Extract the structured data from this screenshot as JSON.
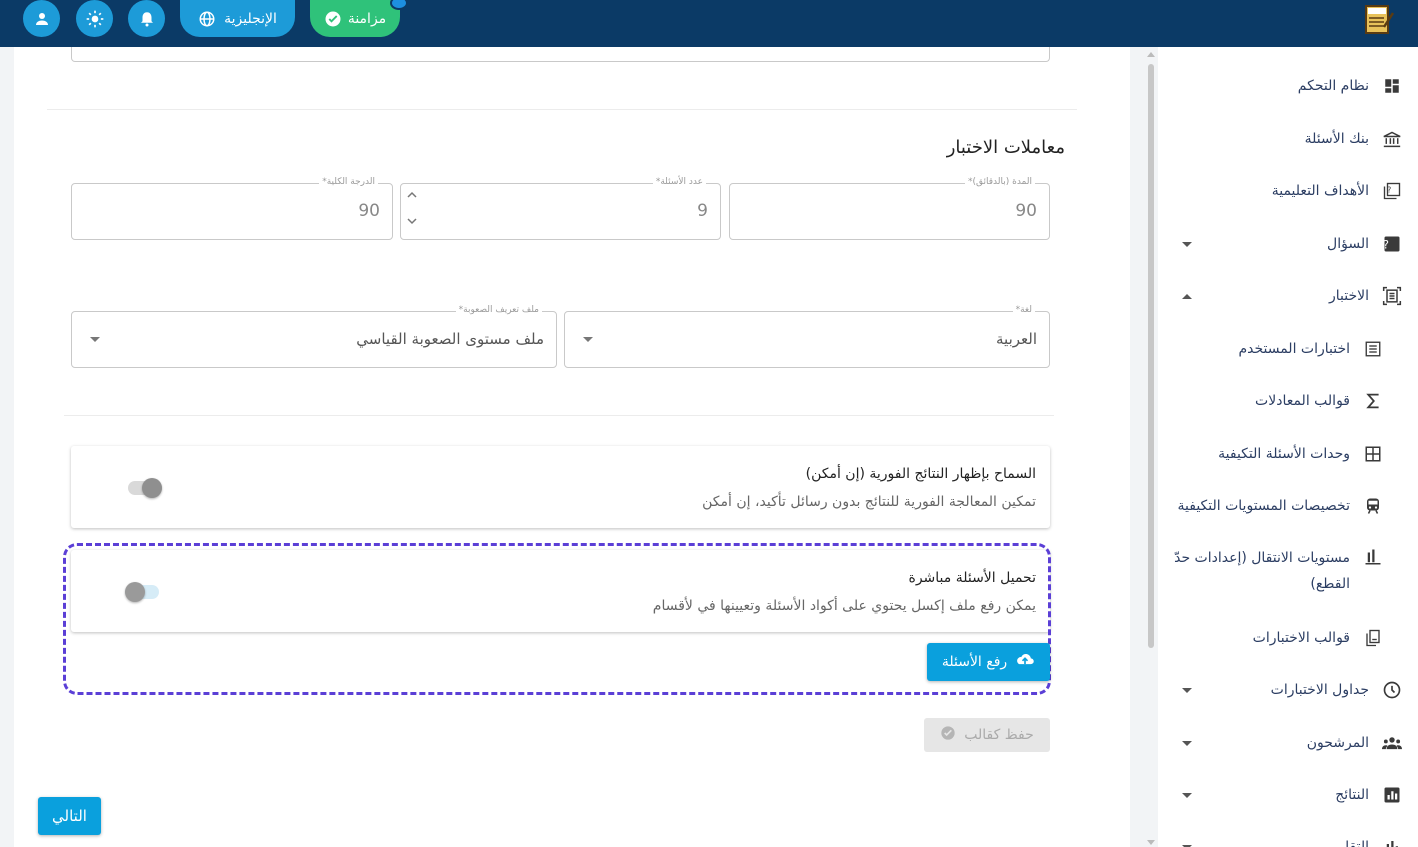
{
  "header": {
    "language_label": "الإنجليزية",
    "sync_label": "مزامنة",
    "icons": [
      "user-icon",
      "sun-icon",
      "bell-icon",
      "globe-icon",
      "check-circle-icon",
      "exam-logo-icon"
    ]
  },
  "main": {
    "section_title": "معاملات الاختبار",
    "fields": {
      "total_score": {
        "label": "الدرجة الكلية*",
        "value": "90"
      },
      "question_count": {
        "label": "عدد الأسئلة*",
        "value": "9"
      },
      "duration": {
        "label": "المدة (بالدقائق)*",
        "value": "90"
      },
      "difficulty_profile": {
        "label": "ملف تعريف الصعوبة*",
        "value": "ملف مستوى الصعوبة القياسي"
      },
      "language": {
        "label": "لغة*",
        "value": "العربية"
      }
    },
    "instant_results": {
      "title": "السماح بإظهار النتائج الفورية (إن أمكن)",
      "description": "تمكين المعالجة الفورية للنتائج بدون رسائل تأكيد، إن أمكن",
      "enabled": true
    },
    "direct_upload": {
      "title": "تحميل الأسئلة مباشرة",
      "description": "يمكن رفع ملف إكسل يحتوي على أكواد الأسئلة وتعيينها في لأقسام",
      "enabled": false,
      "upload_button": "رفع الأسئلة"
    },
    "save_template_button": "حفظ كقالب",
    "next_button": "التالي"
  },
  "sidebar": {
    "items": [
      {
        "label": "نظام التحكم",
        "icon": "dashboard-icon"
      },
      {
        "label": "بنك الأسئلة",
        "icon": "bank-icon"
      },
      {
        "label": "الأهداف التعليمية",
        "icon": "objectives-icon"
      },
      {
        "label": "السؤال",
        "icon": "question-icon",
        "expandable": true
      },
      {
        "label": "الاختبار",
        "icon": "exam-icon",
        "expanded": true
      },
      {
        "label": "اختبارات المستخدم",
        "icon": "list-icon"
      },
      {
        "label": "قوالب المعادلات",
        "icon": "sigma-icon"
      },
      {
        "label": "وحدات الأسئلة التكيفية",
        "icon": "grid-icon"
      },
      {
        "label": "تخصيصات المستويات التكيفية",
        "icon": "train-icon"
      },
      {
        "label": "مستويات الانتقال (إعدادات حدّ القطع)",
        "icon": "bar-icon"
      },
      {
        "label": "قوالب الاختبارات",
        "icon": "template-icon"
      },
      {
        "label": "جداول الاختبارات",
        "icon": "clock-icon",
        "expandable": true
      },
      {
        "label": "المرشحون",
        "icon": "people-icon",
        "expandable": true
      },
      {
        "label": "النتائج",
        "icon": "chart-icon",
        "expandable": true
      },
      {
        "label": "التقارير",
        "icon": "report-icon",
        "expandable": true
      }
    ]
  },
  "colors": {
    "header": "#0b3a66",
    "accent": "#0aa0dd",
    "sync": "#2fc27a",
    "dashed_border": "#5b3fd6"
  }
}
